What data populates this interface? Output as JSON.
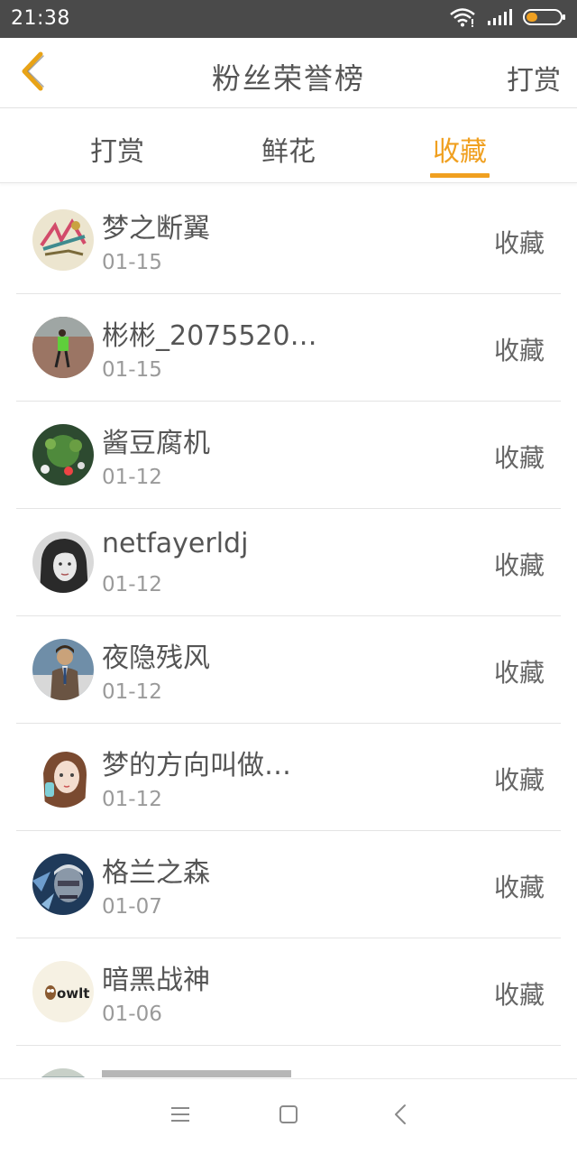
{
  "status": {
    "time": "21:38",
    "icons": [
      "wifi-icon",
      "signal-icon",
      "battery-icon"
    ],
    "battery_color": "#f0a020"
  },
  "header": {
    "title": "粉丝荣誉榜",
    "right_action": "打赏",
    "back_icon": "chevron-left-icon",
    "accent": "#f0a020"
  },
  "tabs": [
    {
      "label": "打赏",
      "active": false
    },
    {
      "label": "鲜花",
      "active": false
    },
    {
      "label": "收藏",
      "active": true
    }
  ],
  "list": {
    "items": [
      {
        "name": "梦之断翼",
        "date": "01-15",
        "action": "收藏"
      },
      {
        "name": "彬彬_2075520…",
        "date": "01-15",
        "action": "收藏"
      },
      {
        "name": "酱豆腐机",
        "date": "01-12",
        "action": "收藏"
      },
      {
        "name": "netfayerldj",
        "date": "01-12",
        "action": "收藏"
      },
      {
        "name": "夜隐残风",
        "date": "01-12",
        "action": "收藏"
      },
      {
        "name": "梦的方向叫做…",
        "date": "01-12",
        "action": "收藏"
      },
      {
        "name": "格兰之森",
        "date": "01-07",
        "action": "收藏"
      },
      {
        "name": "暗黑战神",
        "date": "01-06",
        "action": "收藏",
        "avatar_text": "owlt"
      }
    ]
  },
  "navbar": {
    "icons": [
      "menu-icon",
      "home-square-icon",
      "back-triangle-icon"
    ]
  }
}
